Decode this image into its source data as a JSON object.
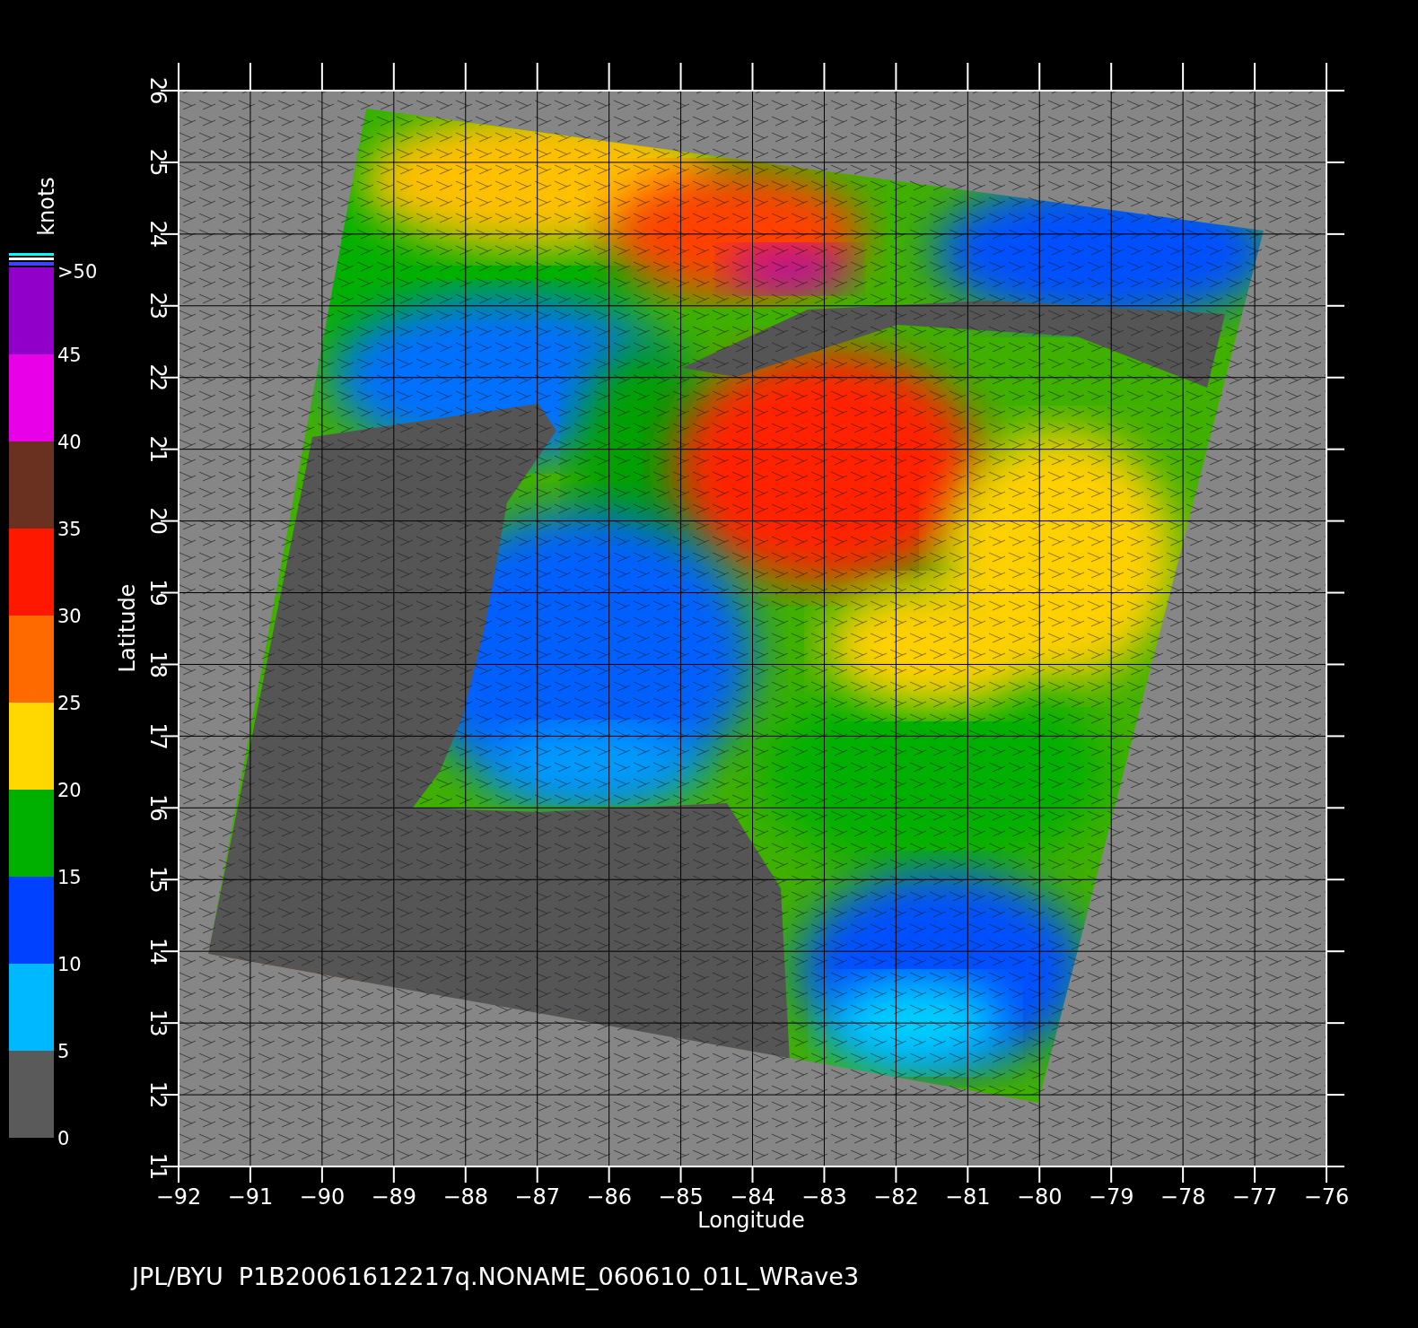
{
  "plot": {
    "xlabel": "Longitude",
    "ylabel": "Latitude",
    "xticks": [
      "−92",
      "−91",
      "−90",
      "−89",
      "−88",
      "−87",
      "−86",
      "−85",
      "−84",
      "−83",
      "−82",
      "−81",
      "−80",
      "−79",
      "−78",
      "−77",
      "−76"
    ],
    "yticks": [
      "26",
      "25",
      "24",
      "23",
      "22",
      "21",
      "20",
      "19",
      "18",
      "17",
      "16",
      "15",
      "14",
      "13",
      "12",
      "11"
    ]
  },
  "colorbar": {
    "unit": "knots",
    "top_label": ">50",
    "segments": [
      {
        "label": "45",
        "color": "#9000c8"
      },
      {
        "label": "40",
        "color": "#e800e8"
      },
      {
        "label": "35",
        "color": "#6a3020"
      },
      {
        "label": "30",
        "color": "#ff1800"
      },
      {
        "label": "25",
        "color": "#ff6a00"
      },
      {
        "label": "20",
        "color": "#ffd800"
      },
      {
        "label": "15",
        "color": "#00b000"
      },
      {
        "label": "10",
        "color": "#0040ff"
      },
      {
        "label": "5",
        "color": "#00b8ff"
      },
      {
        "label": "0",
        "color": "#5a5a5a"
      }
    ]
  },
  "caption": "JPL/BYU  P1B20061612217q.NONAME_060610_01L_WRave3"
}
